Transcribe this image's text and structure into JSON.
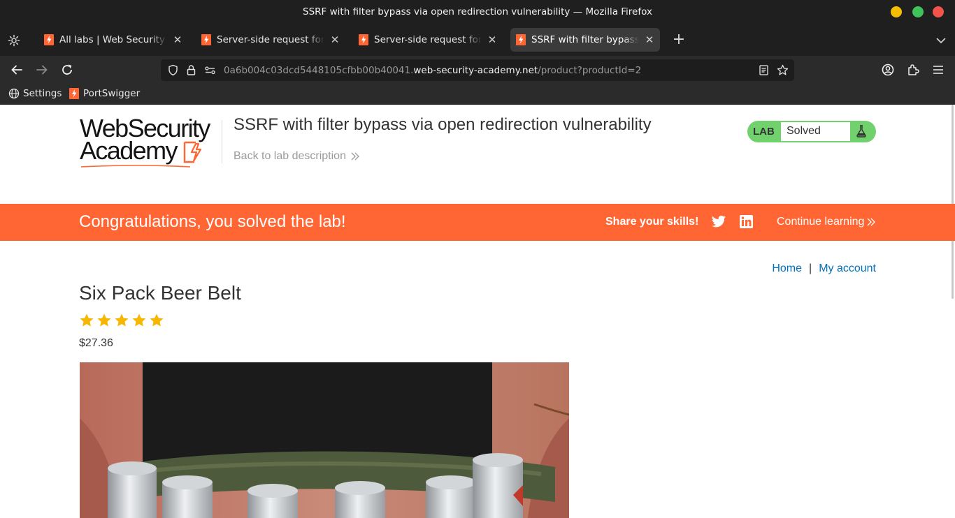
{
  "window": {
    "title": "SSRF with filter bypass via open redirection vulnerability — Mozilla Firefox"
  },
  "tabs": [
    {
      "label": "All labs | Web Security Academy",
      "active": false
    },
    {
      "label": "Server-side request forgery (SSRF)",
      "active": false
    },
    {
      "label": "Server-side request forgery (SSRF)",
      "active": false
    },
    {
      "label": "SSRF with filter bypass via open redirection vulnerability",
      "active": true
    }
  ],
  "urlbar": {
    "url_prefix": "0a6b004c03dcd5448105cfbb00b40041.",
    "url_host": "web-security-academy.net",
    "url_path": "/product?productId=2"
  },
  "bookmarks": [
    {
      "label": "Settings",
      "icon": "globe-icon"
    },
    {
      "label": "PortSwigger",
      "icon": "portswigger-icon"
    }
  ],
  "header": {
    "logo_line1": "WebSecurity",
    "logo_line2": "Academy",
    "lab_title": "SSRF with filter bypass via open redirection vulnerability",
    "back_link": "Back to lab description",
    "badge_label": "LAB",
    "badge_status": "Solved"
  },
  "banner": {
    "message": "Congratulations, you solved the lab!",
    "share_label": "Share your skills!",
    "continue_label": "Continue learning"
  },
  "nav": {
    "home": "Home",
    "separator": "|",
    "account": "My account"
  },
  "product": {
    "name": "Six Pack Beer Belt",
    "rating": 5,
    "price": "$27.36"
  },
  "colors": {
    "brand_orange": "#ff6633",
    "badge_green": "#70d16d",
    "link_blue": "#0071bc",
    "star_yellow": "#f7b600"
  }
}
